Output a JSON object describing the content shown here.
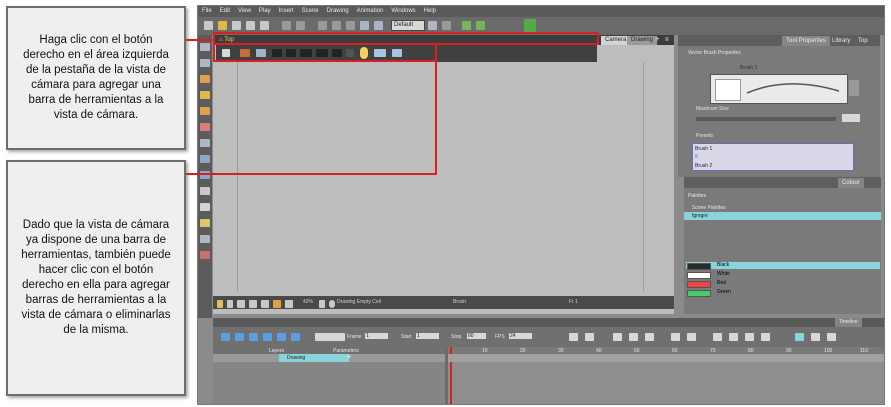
{
  "callouts": {
    "top": "Haga clic con el botón derecho en el área izquierda de la pestaña de la vista de cámara para agregar una barra de herramientas a la vista de cámara.",
    "bottom": "Dado que la vista de cámara ya dispone de una barra de herramientas, también puede hacer clic con el botón derecho en ella para agregar barras de herramientas a la vista de cámara o eliminarlas de la misma."
  },
  "menu": [
    "File",
    "Edit",
    "View",
    "Play",
    "Insert",
    "Scene",
    "Drawing",
    "Animation",
    "Windows",
    "Help"
  ],
  "toolbar": {
    "workspace_select": "Default"
  },
  "camera": {
    "top_tab": "Top",
    "tabs": [
      "Camera",
      "Drawing"
    ],
    "status": {
      "zoom": "42%",
      "mode": "Drawing Empty Cell",
      "tool": "Brush",
      "frame": "Fr 1"
    }
  },
  "tool_properties": {
    "tabs": [
      "Tool Properties",
      "Library",
      "Top"
    ],
    "section": "Vector Brush Properties",
    "brush_preview_label": "Brush 1",
    "max_size_label": "Maximum Size",
    "presets_label": "Presets",
    "presets": [
      {
        "name": "Brush 1",
        "size": "5"
      },
      {
        "name": "Brush 2"
      }
    ]
  },
  "colour": {
    "tab": "Colour",
    "palettes_label": "Palettes",
    "scene_palettes_label": "Scene Palettes",
    "palette_item": "fgregre",
    "swatches": [
      {
        "name": "Black",
        "color": "#2b2b2b"
      },
      {
        "name": "White",
        "color": "#ffffff"
      },
      {
        "name": "Red",
        "color": "#ee4444"
      },
      {
        "name": "Green",
        "color": "#44cc66"
      }
    ]
  },
  "timeline": {
    "tab": "Timeline",
    "frame_label": "Frame",
    "frame_value": "1",
    "start_label": "Start",
    "start_value": "1",
    "stop_label": "Stop",
    "stop_value": "60",
    "fps_label": "FPS",
    "fps_value": "24",
    "layers_col": "Layers",
    "params_col": "Parameters",
    "layer_name": "Drawing",
    "ruler": [
      "10",
      "20",
      "30",
      "40",
      "50",
      "60",
      "70",
      "80",
      "90",
      "100",
      "110"
    ]
  },
  "colors": {
    "highlight": "#d82020",
    "selection": "#8ad4dc"
  }
}
